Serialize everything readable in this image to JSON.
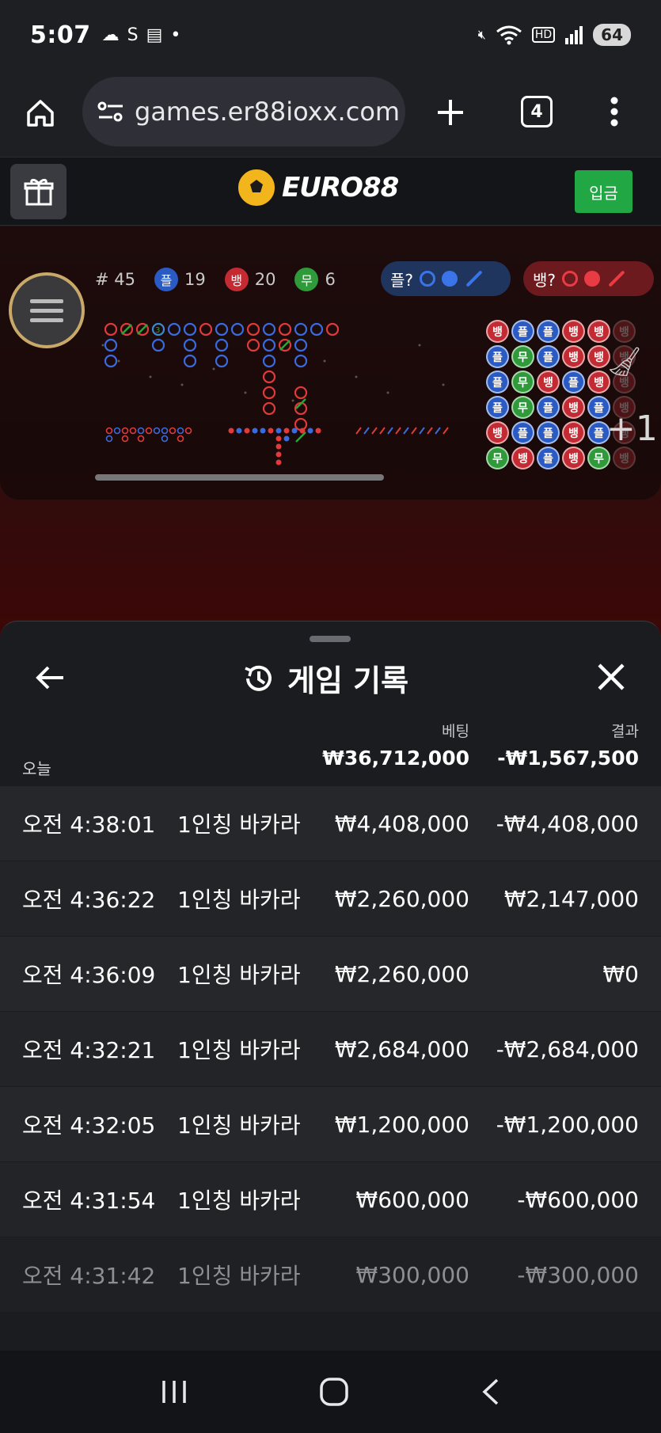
{
  "status": {
    "time": "5:07",
    "battery": "64"
  },
  "browser": {
    "url": "games.er88ioxx.com",
    "tab_count": "4"
  },
  "site": {
    "logo_text": "EURO88",
    "deposit_label": "입금"
  },
  "game": {
    "round": "# 45",
    "player": {
      "badge": "플",
      "count": "19"
    },
    "banker": {
      "badge": "뱅",
      "count": "20"
    },
    "tie": {
      "badge": "무",
      "count": "6"
    },
    "player_predict_label": "플?",
    "banker_predict_label": "뱅?",
    "overflow_count": "+1",
    "bead_rows": [
      [
        "뱅",
        "플",
        "플",
        "뱅",
        "뱅",
        "뱅"
      ],
      [
        "플",
        "무",
        "플",
        "뱅",
        "뱅",
        "뱅"
      ],
      [
        "플",
        "무",
        "뱅",
        "플",
        "뱅",
        "뱅"
      ],
      [
        "플",
        "무",
        "플",
        "뱅",
        "플",
        "뱅"
      ],
      [
        "뱅",
        "플",
        "플",
        "뱅",
        "플",
        "뱅"
      ],
      [
        "무",
        "뱅",
        "플",
        "뱅",
        "무",
        "뱅"
      ]
    ],
    "colors": {
      "player": "#2a5bc4",
      "banker": "#c42a32",
      "tie": "#2f9a3a"
    }
  },
  "sheet": {
    "title": "게임 기록",
    "col_bet": "베팅",
    "col_result": "결과",
    "today_label": "오늘",
    "today_bet": "₩36,712,000",
    "today_result": "-₩1,567,500",
    "rows": [
      {
        "time": "오전 4:38:01",
        "game": "1인칭 바카라",
        "bet": "₩4,408,000",
        "result": "-₩4,408,000"
      },
      {
        "time": "오전 4:36:22",
        "game": "1인칭 바카라",
        "bet": "₩2,260,000",
        "result": "₩2,147,000"
      },
      {
        "time": "오전 4:36:09",
        "game": "1인칭 바카라",
        "bet": "₩2,260,000",
        "result": "₩0"
      },
      {
        "time": "오전 4:32:21",
        "game": "1인칭 바카라",
        "bet": "₩2,684,000",
        "result": "-₩2,684,000"
      },
      {
        "time": "오전 4:32:05",
        "game": "1인칭 바카라",
        "bet": "₩1,200,000",
        "result": "-₩1,200,000"
      },
      {
        "time": "오전 4:31:54",
        "game": "1인칭 바카라",
        "bet": "₩600,000",
        "result": "-₩600,000"
      },
      {
        "time": "오전 4:31:42",
        "game": "1인칭 바카라",
        "bet": "₩300,000",
        "result": "-₩300,000"
      }
    ]
  }
}
